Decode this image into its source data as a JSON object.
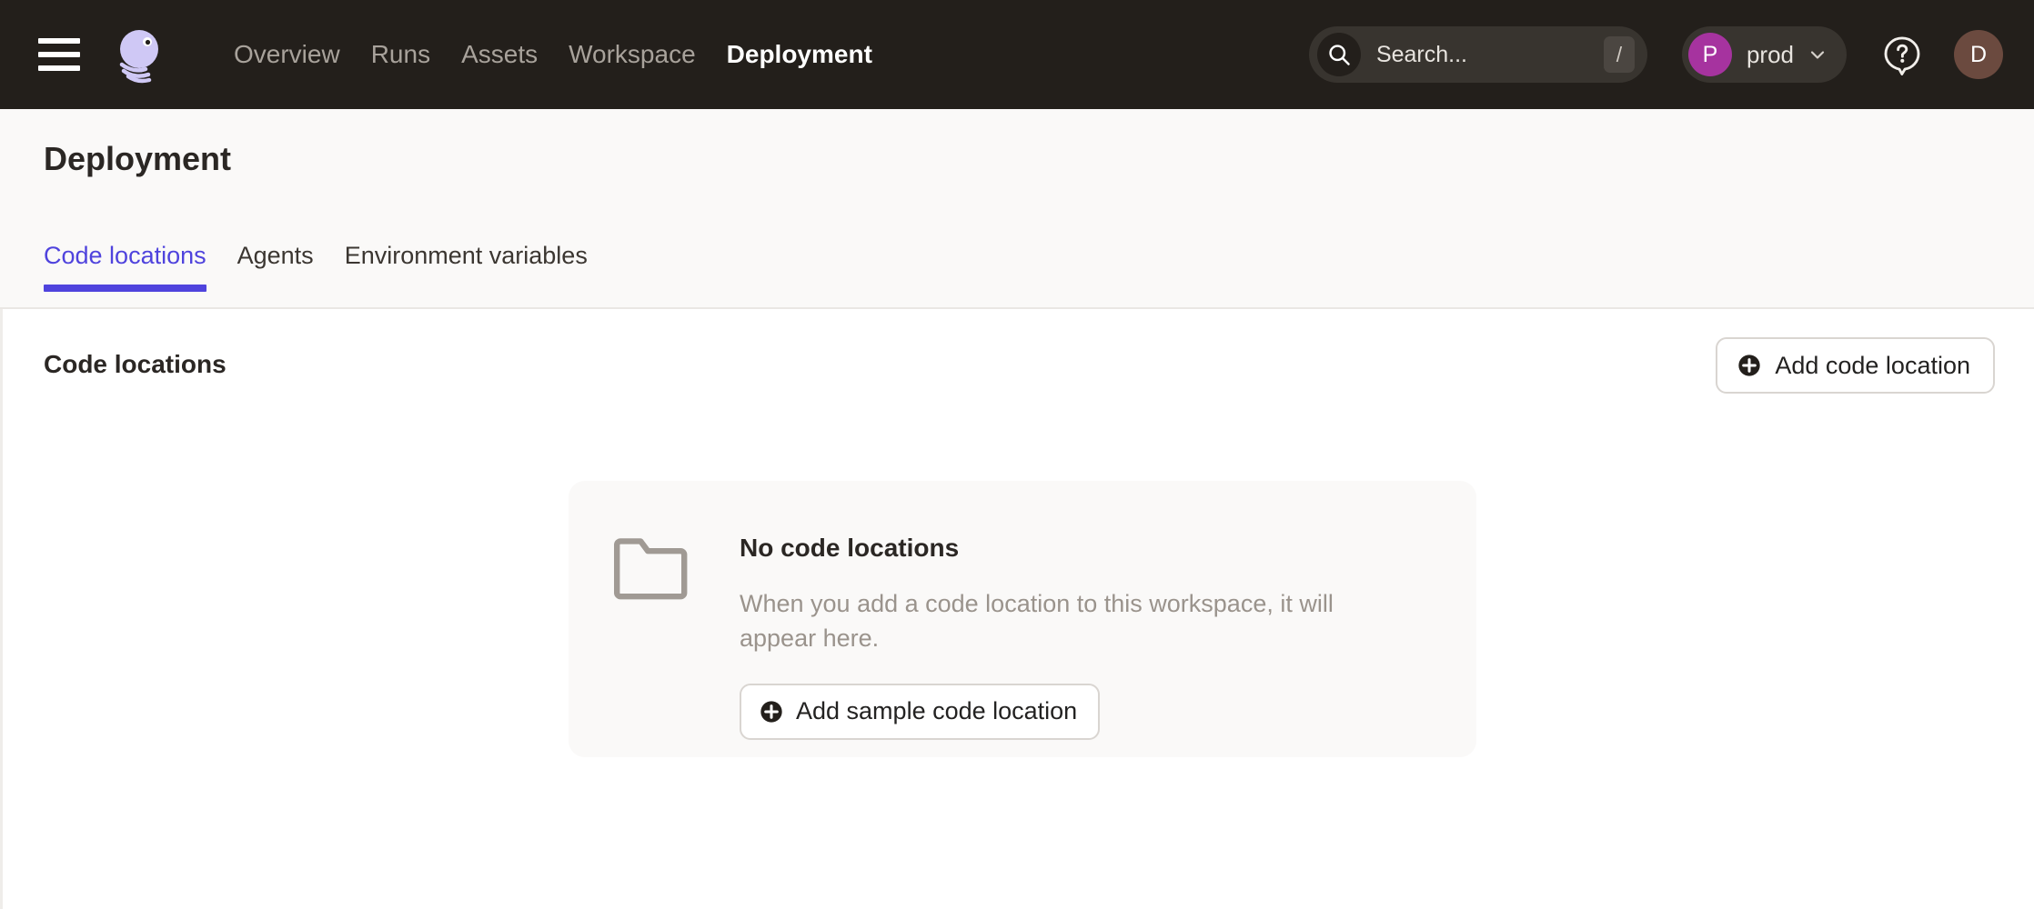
{
  "topbar": {
    "menu_icon": "hamburger-menu-icon",
    "logo_icon": "dagster-logo-icon",
    "nav": [
      {
        "label": "Overview",
        "active": false
      },
      {
        "label": "Runs",
        "active": false
      },
      {
        "label": "Assets",
        "active": false
      },
      {
        "label": "Workspace",
        "active": false
      },
      {
        "label": "Deployment",
        "active": true
      }
    ],
    "search": {
      "placeholder": "Search...",
      "value": "",
      "shortcut": "/",
      "icon": "search-icon"
    },
    "deployment_selector": {
      "badge": "P",
      "name": "prod",
      "badge_color": "#A6339F",
      "chevron": "chevron-down-icon"
    },
    "help_icon": "help-question-icon",
    "avatar": {
      "initial": "D",
      "color": "#6B4A3F"
    }
  },
  "page": {
    "title": "Deployment",
    "tabs": [
      {
        "label": "Code locations",
        "active": true
      },
      {
        "label": "Agents",
        "active": false
      },
      {
        "label": "Environment variables",
        "active": false
      }
    ],
    "active_tab_color": "#4F43DD"
  },
  "main": {
    "section_title": "Code locations",
    "add_button_label": "Add code location",
    "empty_state": {
      "icon": "folder-icon",
      "title": "No code locations",
      "description": "When you add a code location to this workspace, it will appear here.",
      "button_label": "Add sample code location"
    }
  }
}
